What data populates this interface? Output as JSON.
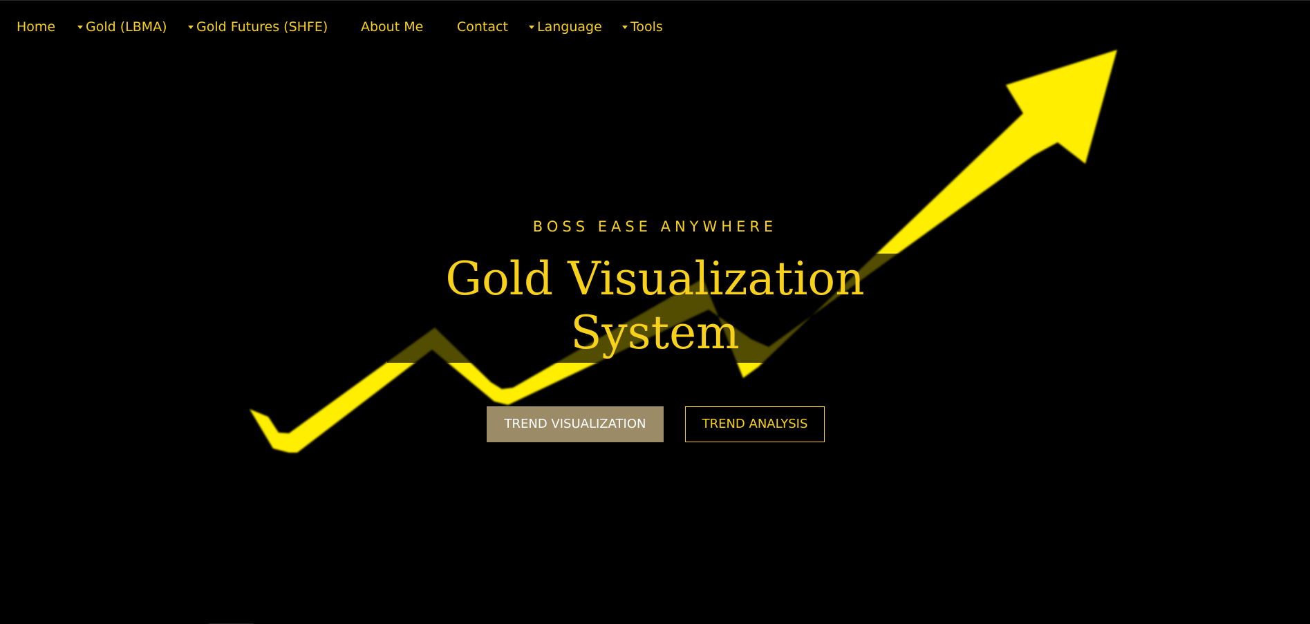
{
  "nav": {
    "items": [
      {
        "label": "Home",
        "dropdown": false
      },
      {
        "label": "Gold (LBMA)",
        "dropdown": true
      },
      {
        "label": "Gold Futures (SHFE)",
        "dropdown": true
      },
      {
        "label": "About Me",
        "dropdown": false
      },
      {
        "label": "Contact",
        "dropdown": false
      },
      {
        "label": "Language",
        "dropdown": true
      },
      {
        "label": "Tools",
        "dropdown": true
      }
    ]
  },
  "hero": {
    "eyebrow": "BOSS EASE ANYWHERE",
    "title_line1": "Gold Visualization",
    "title_line2": "System",
    "primary_button": "TREND VISUALIZATION",
    "secondary_button": "TREND ANALYSIS",
    "background_graphic": "rising-trend-arrow-icon"
  },
  "colors": {
    "background": "#000000",
    "accent": "#f7d11a",
    "arrow": "#ffee00",
    "primary_button_bg": "#9b8b66",
    "primary_button_text": "#ffffff"
  }
}
